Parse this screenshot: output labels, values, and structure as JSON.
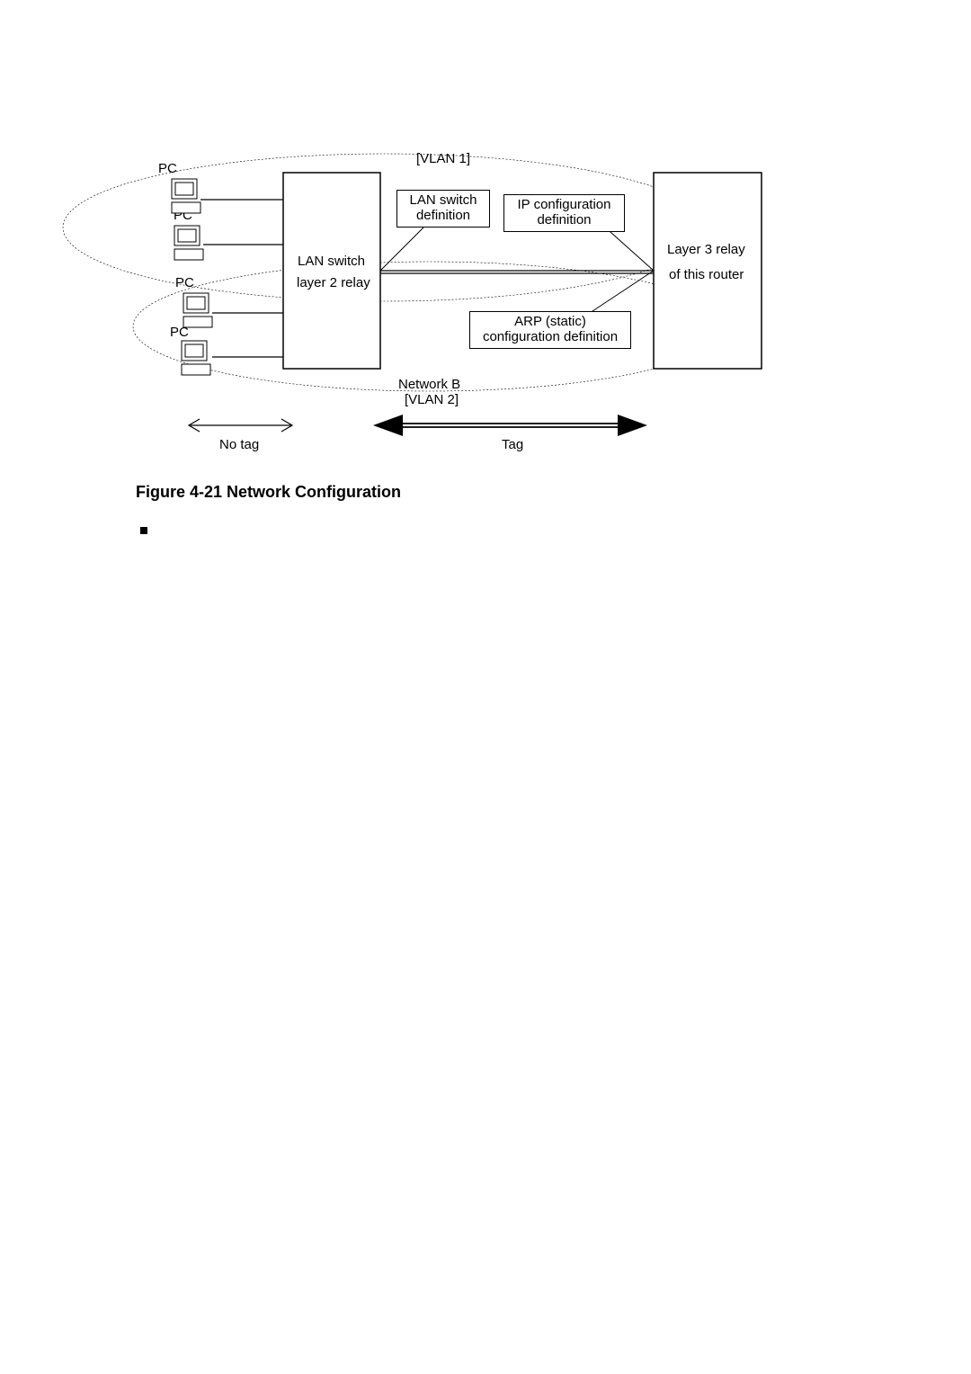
{
  "labels": {
    "vlan1": "[VLAN 1]",
    "vlan2": "[VLAN 2]",
    "networkB": "Network B",
    "pc1": "PC",
    "pc2": "PC",
    "pc3": "PC",
    "pc4": "PC",
    "lanSwitch_line1": "LAN switch",
    "lanSwitch_line2": "layer 2 relay",
    "lanDef_line1": "LAN switch",
    "lanDef_line2": "definition",
    "ipDef_line1": "IP configuration",
    "ipDef_line2": "definition",
    "arp_line1": "ARP (static)",
    "arp_line2": "configuration definition",
    "router_line1": "Layer 3 relay",
    "router_line2": "of this router",
    "noTag": "No tag",
    "tag": "Tag"
  },
  "caption": "Figure 4-21 Network Configuration"
}
